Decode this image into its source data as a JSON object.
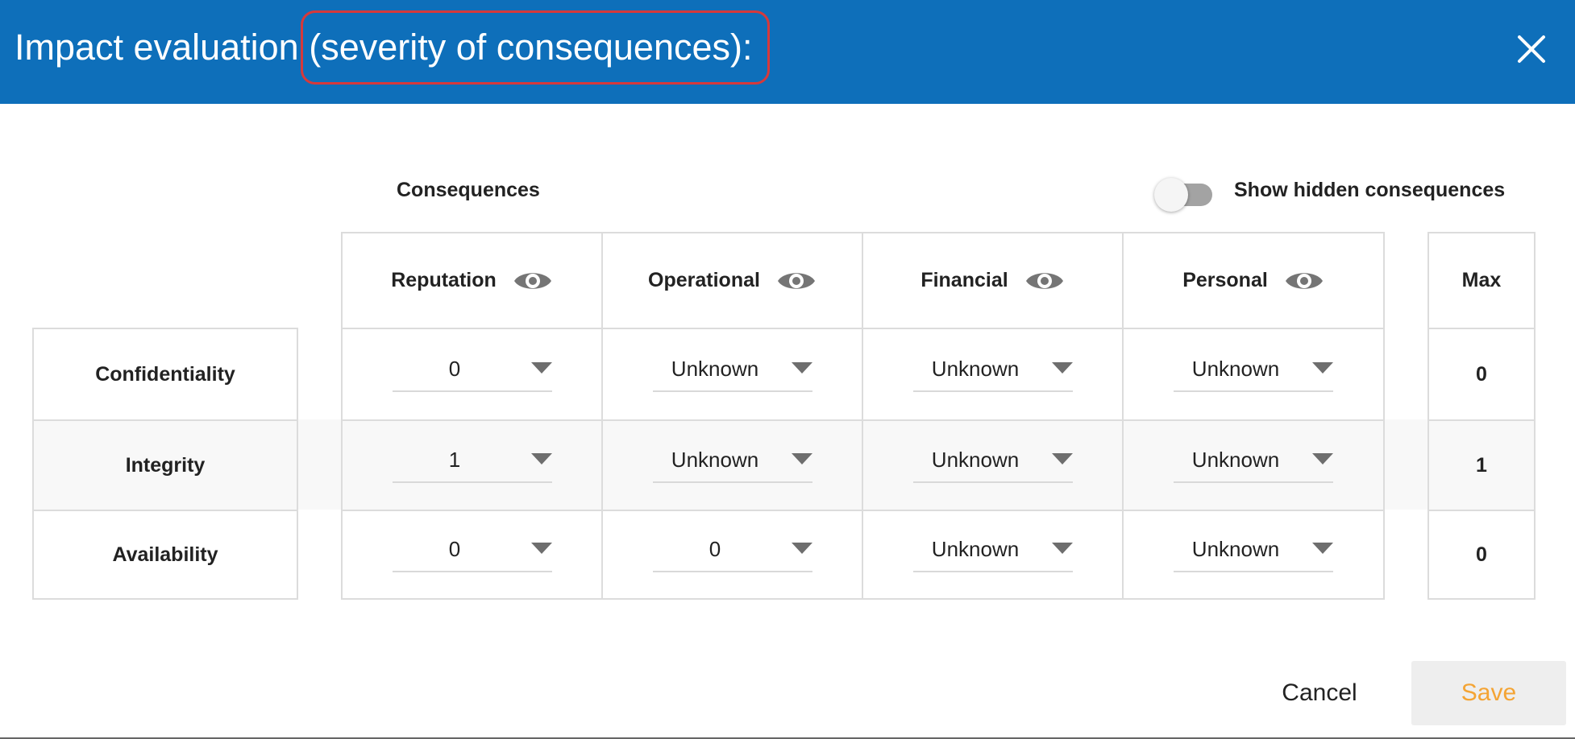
{
  "dialog": {
    "title_main": "Impact evaluation ",
    "title_highlight": "(severity of consequences):",
    "accent_color": "#0e6fba",
    "highlight_color": "#d6393b",
    "close_icon": "close-icon"
  },
  "consequences_heading": "Consequences",
  "toggle": {
    "label": "Show hidden consequences",
    "checked": false
  },
  "columns": [
    {
      "label": "Reputation",
      "icon": "eye-icon"
    },
    {
      "label": "Operational",
      "icon": "eye-icon"
    },
    {
      "label": "Financial",
      "icon": "eye-icon"
    },
    {
      "label": "Personal",
      "icon": "eye-icon"
    }
  ],
  "max_header": "Max",
  "rows": [
    {
      "label": "Confidentiality",
      "values": [
        "0",
        "Unknown",
        "Unknown",
        "Unknown"
      ],
      "max": "0"
    },
    {
      "label": "Integrity",
      "values": [
        "1",
        "Unknown",
        "Unknown",
        "Unknown"
      ],
      "max": "1"
    },
    {
      "label": "Availability",
      "values": [
        "0",
        "0",
        "Unknown",
        "Unknown"
      ],
      "max": "0"
    }
  ],
  "footer": {
    "cancel_label": "Cancel",
    "save_label": "Save",
    "save_color": "#f4a434"
  }
}
